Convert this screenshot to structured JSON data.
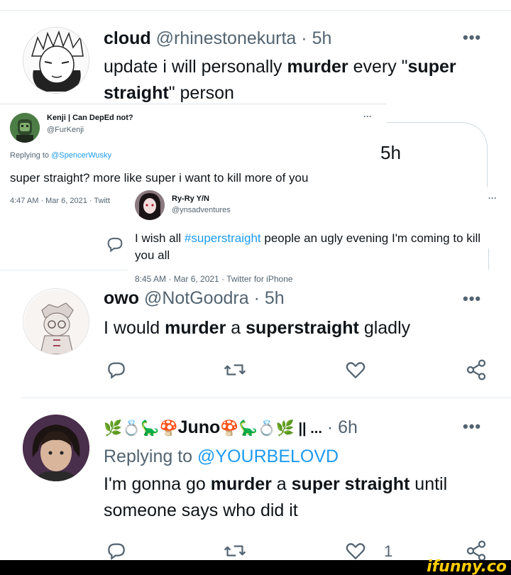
{
  "tweet1": {
    "name": "cloud",
    "handle": "@rhinestonekurta",
    "time": "· 5h",
    "more": "•••",
    "text_parts": [
      {
        "t": "update i will personally ",
        "b": false
      },
      {
        "t": "murder",
        "b": true
      },
      {
        "t": " every \"",
        "b": false
      },
      {
        "t": "super straight",
        "b": true
      },
      {
        "t": "\" person",
        "b": false
      }
    ]
  },
  "screenshot1": {
    "name": "Kenji | Can DepEd not?",
    "handle": "@FurKenji",
    "more": "···",
    "reply_prefix": "Replying to ",
    "reply_handle": "@SpencerWusky",
    "text": "super straight? more like super i want to kill more of you",
    "meta": "4:47 AM · Mar 6, 2021 · Twitt",
    "partial_time": "5h"
  },
  "screenshot2": {
    "name": "Ry-Ry Y/N",
    "handle": "@ynsadventures",
    "more": "···",
    "text_before": "I wish all ",
    "hashtag": "#superstraight",
    "text_after": " people an ugly evening I'm coming to kill you all",
    "meta": "8:45 AM · Mar 6, 2021 · Twitter for iPhone"
  },
  "tweet2": {
    "name": "owo",
    "handle": "@NotGoodra",
    "time": "· 5h",
    "more": "•••",
    "text_parts": [
      {
        "t": "I would ",
        "b": false
      },
      {
        "t": "murder",
        "b": true
      },
      {
        "t": " a ",
        "b": false
      },
      {
        "t": "superstraight",
        "b": true
      },
      {
        "t": " gladly",
        "b": false
      }
    ]
  },
  "tweet3": {
    "name_emoji_left": "🌿💍🦕🍄",
    "name": "Juno",
    "name_emoji_right": "🍄🦕💍🌿",
    "name_suffix": " || ...",
    "time": "· 6h",
    "more": "•••",
    "reply_prefix": "Replying to ",
    "reply_handle": "@YOURBELOVD",
    "text_parts": [
      {
        "t": "I'm gonna go ",
        "b": false
      },
      {
        "t": "murder",
        "b": true
      },
      {
        "t": " a ",
        "b": false
      },
      {
        "t": "super straight",
        "b": true
      },
      {
        "t": " until someone says who did it",
        "b": false
      }
    ],
    "like_count": "1"
  },
  "watermark": "ifunny.co",
  "icons": [
    "reply-icon",
    "retweet-icon",
    "like-icon",
    "share-icon"
  ]
}
